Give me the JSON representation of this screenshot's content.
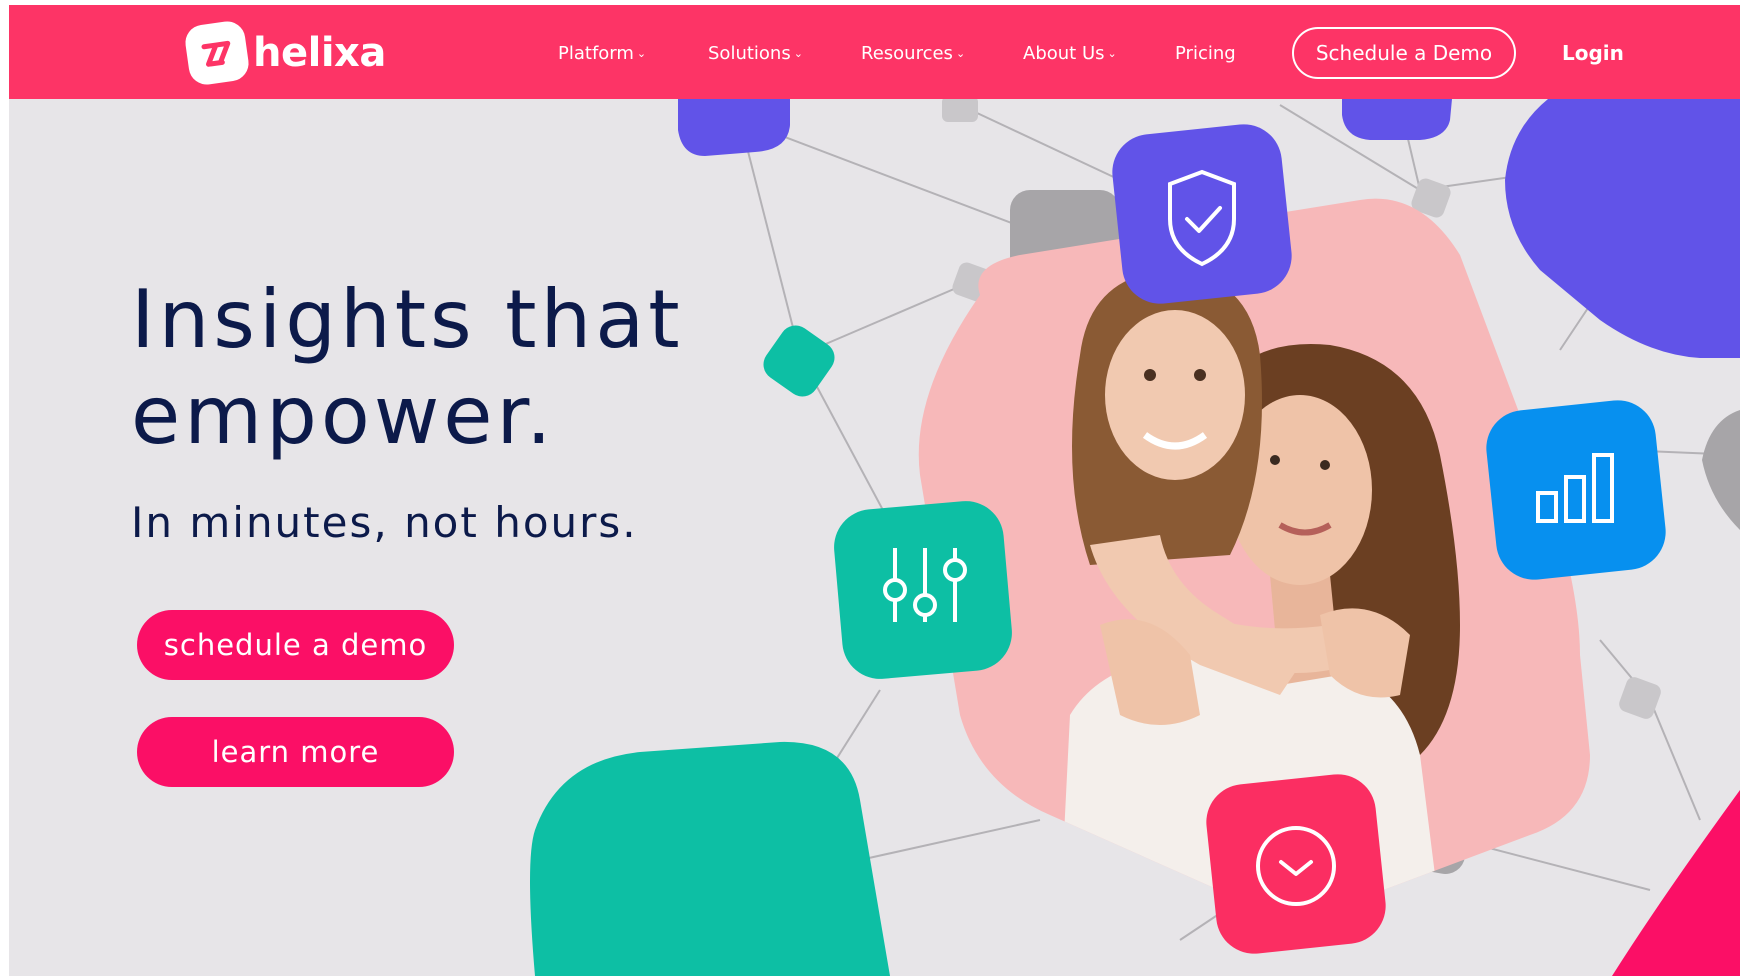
{
  "brand": {
    "name": "helixa",
    "color": "#fd3466"
  },
  "nav": {
    "items": [
      {
        "label": "Platform",
        "has_dropdown": true
      },
      {
        "label": "Solutions",
        "has_dropdown": true
      },
      {
        "label": "Resources",
        "has_dropdown": true
      },
      {
        "label": "About Us",
        "has_dropdown": true
      },
      {
        "label": "Pricing",
        "has_dropdown": false
      }
    ],
    "cta_label": "Schedule a Demo",
    "login_label": "Login"
  },
  "hero": {
    "title_line1": "Insights that",
    "title_line2": "empower.",
    "subtitle": "In minutes, not hours.",
    "primary_button": "schedule a demo",
    "secondary_button": "learn more"
  },
  "icons": [
    "shield-check-icon",
    "sliders-icon",
    "bar-chart-icon",
    "clock-icon"
  ],
  "colors": {
    "navbar": "#fd3466",
    "button": "#fb0f66",
    "heading": "#0c1a4a",
    "purple": "#6153e8",
    "teal": "#0dbfa4",
    "blue": "#0790ef",
    "pink_bg": "#f7b8b9",
    "page_bg": "#e7e5e8"
  }
}
